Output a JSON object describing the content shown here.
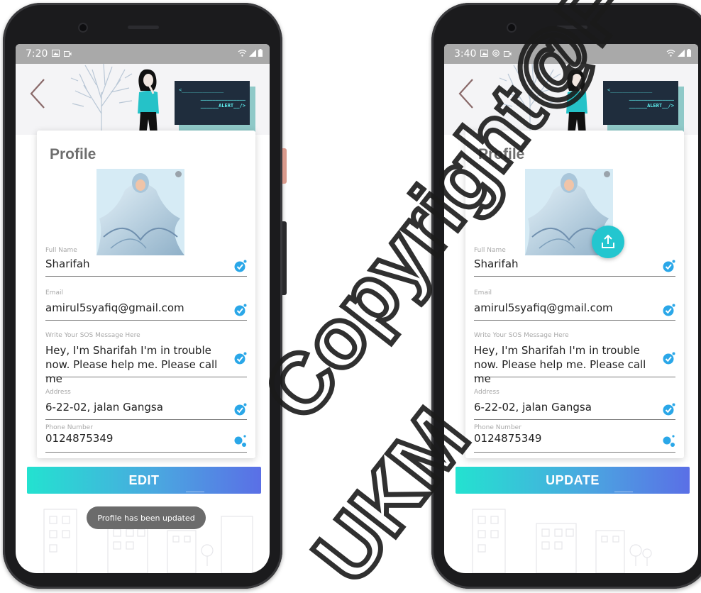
{
  "colors": {
    "accent_teal": "#23c6cf",
    "check_blue": "#2aa7e8",
    "button_gradient_start": "#23e2d0",
    "button_gradient_end": "#5a6fe6",
    "status_bar": "#a9a9a9",
    "terminal_bg": "#1f2d3d",
    "terminal_text": "#5ff0f0"
  },
  "icons": {
    "back": "chevron-left-icon",
    "check": "check-badge-icon",
    "dots": "dots-icon",
    "upload": "upload-icon",
    "gallery": "gallery-icon",
    "video": "video-icon",
    "wifi": "wifi-icon",
    "signal": "signal-icon",
    "battery": "battery-icon"
  },
  "header": {
    "terminal_line1": "<______________",
    "terminal_line2": "_______________",
    "terminal_line3": "______ALERT__/>"
  },
  "screens": [
    {
      "status_time": "7:20",
      "card_title": "Profile",
      "fields": [
        {
          "label": "Full Name",
          "value": "Sharifah"
        },
        {
          "label": "Email",
          "value": "amirul5syafiq@gmail.com"
        },
        {
          "label": "Write Your SOS Message Here",
          "value": "Hey, I'm Sharifah I'm in trouble now. Please help me. Please call me"
        },
        {
          "label": "Address",
          "value": "6-22-02, jalan Gangsa"
        },
        {
          "label": "Phone Number",
          "value": "0124875349"
        }
      ],
      "button_label": "EDIT",
      "toast": "Profile has been updated"
    },
    {
      "status_time": "3:40",
      "card_title": "Profile",
      "fields": [
        {
          "label": "Full Name",
          "value": "Sharifah"
        },
        {
          "label": "Email",
          "value": "amirul5syafiq@gmail.com"
        },
        {
          "label": "Write Your SOS Message Here",
          "value": "Hey, I'm Sharifah I'm in trouble now. Please help me. Please call me"
        },
        {
          "label": "Address",
          "value": "6-22-02, jalan Gangsa"
        },
        {
          "label": "Phone Number",
          "value": "0124875349"
        }
      ],
      "button_label": "UPDATE"
    }
  ],
  "watermark": {
    "line1": "Copyright@FTSM",
    "line2": "UKM"
  }
}
